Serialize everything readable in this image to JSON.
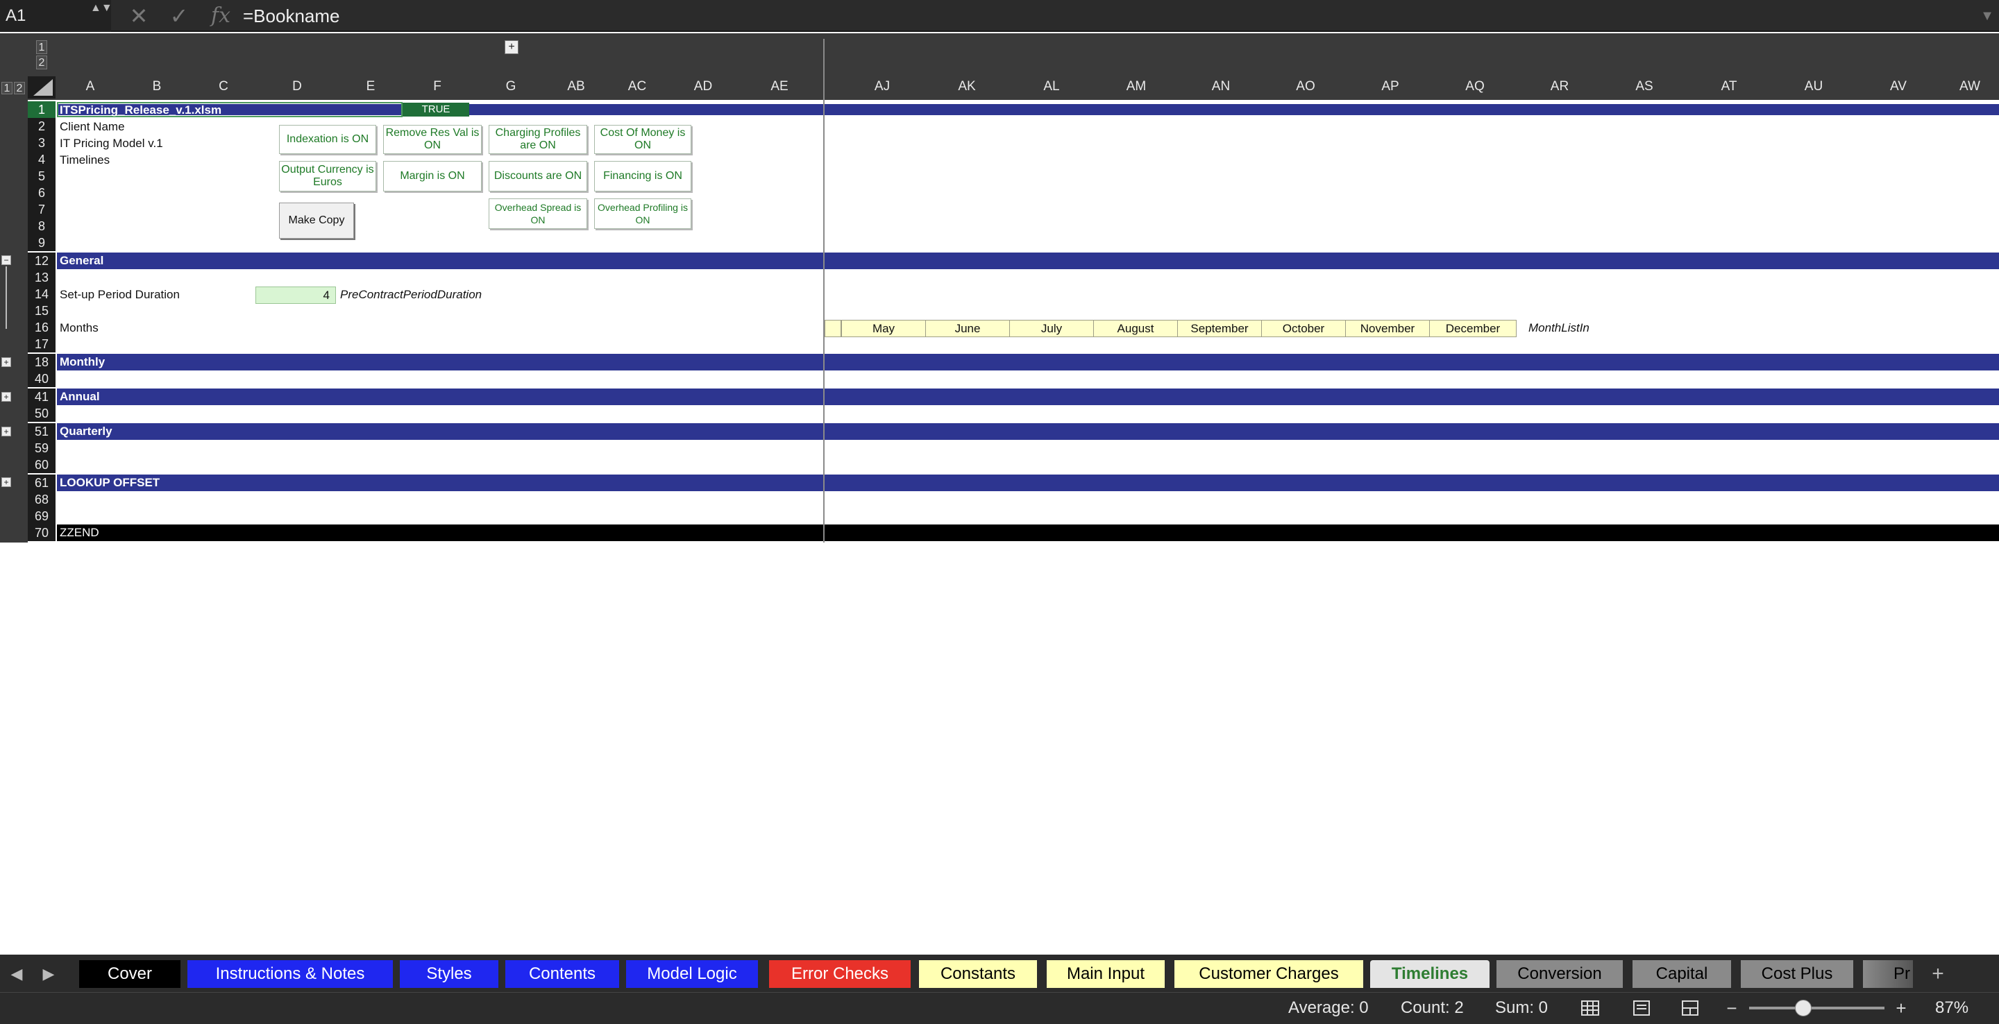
{
  "formula_bar": {
    "name_box": "A1",
    "spinner": "▲▼",
    "cancel_icon": "✕",
    "enter_icon": "✓",
    "fx_icon": "fx",
    "formula": "=Bookname"
  },
  "outline": {
    "levels": [
      "1",
      "2"
    ],
    "col_level_1": "1",
    "col_level_2": "2",
    "expand_symbol": "+",
    "collapse_symbol": "−"
  },
  "columns": [
    "A",
    "B",
    "C",
    "D",
    "E",
    "F",
    "G",
    "AB",
    "AC",
    "AD",
    "AE",
    "AJ",
    "AK",
    "AL",
    "AM",
    "AN",
    "AO",
    "AP",
    "AQ",
    "AR",
    "AS",
    "AT",
    "AU",
    "AV",
    "AW"
  ],
  "rows": [
    "1",
    "2",
    "3",
    "4",
    "5",
    "6",
    "7",
    "8",
    "9",
    "12",
    "13",
    "14",
    "15",
    "16",
    "17",
    "18",
    "40",
    "41",
    "50",
    "51",
    "59",
    "60",
    "61",
    "68",
    "69",
    "70"
  ],
  "cells": {
    "a1": "ITSPricing_Release_v.1.xlsm",
    "true_value": "TRUE",
    "a2": "Client Name",
    "a3": "IT Pricing Model v.1",
    "a4": "Timelines",
    "setup_label": "Set-up Period Duration",
    "setup_value": "4",
    "setup_name": "PreContractPeriodDuration",
    "months_label": "Months",
    "months_name": "MonthListIn",
    "zzend": "ZZEND"
  },
  "months": [
    "May",
    "June",
    "July",
    "August",
    "September",
    "October",
    "November",
    "December"
  ],
  "toggles": {
    "indexation": "Indexation is ON",
    "remove_res_val": "Remove Res Val is ON",
    "charging_profiles": "Charging Profiles are ON",
    "cost_of_money": "Cost Of Money is ON",
    "output_currency": "Output Currency is Euros",
    "margin": "Margin is ON",
    "discounts": "Discounts are ON",
    "financing": "Financing is ON",
    "overhead_spread": "Overhead Spread is ON",
    "overhead_profiling": "Overhead Profiling is ON",
    "make_copy": "Make Copy"
  },
  "sections": {
    "general": "General",
    "monthly": "Monthly",
    "annual": "Annual",
    "quarterly": "Quarterly",
    "lookup_offset": "LOOKUP OFFSET"
  },
  "tabs": [
    {
      "label": "Cover",
      "bg": "#000000",
      "fg": "#ffffff"
    },
    {
      "label": "Instructions & Notes",
      "bg": "#1f27f0",
      "fg": "#ffffff"
    },
    {
      "label": "Styles",
      "bg": "#1f27f0",
      "fg": "#ffffff"
    },
    {
      "label": "Contents",
      "bg": "#1f27f0",
      "fg": "#ffffff"
    },
    {
      "label": "Model Logic",
      "bg": "#1f27f0",
      "fg": "#ffffff"
    },
    {
      "label": "Error Checks",
      "bg": "#e8322a",
      "fg": "#ffffff"
    },
    {
      "label": "Constants",
      "bg": "#ffffb3",
      "fg": "#000000"
    },
    {
      "label": "Main Input",
      "bg": "#ffffb3",
      "fg": "#000000"
    },
    {
      "label": "Customer Charges",
      "bg": "#ffffb3",
      "fg": "#000000"
    },
    {
      "label": "Timelines",
      "bg": "#e4e4e4",
      "fg": "#2e7d32"
    },
    {
      "label": "Conversion",
      "bg": "#8a8a8a",
      "fg": "#000000"
    },
    {
      "label": "Capital",
      "bg": "#8a8a8a",
      "fg": "#000000"
    },
    {
      "label": "Cost Plus",
      "bg": "#8a8a8a",
      "fg": "#000000"
    },
    {
      "label": "Pr",
      "bg": "#8a8a8a",
      "fg": "#000000"
    }
  ],
  "tab_nav": {
    "prev": "◀",
    "next": "▶",
    "add": "+"
  },
  "status": {
    "average": "Average: 0",
    "count": "Count: 2",
    "sum": "Sum: 0",
    "zoom_minus": "−",
    "zoom_plus": "+",
    "zoom": "87%",
    "zoom_fraction": 0.4
  },
  "colors": {
    "section_band": "#2d3590",
    "selected_header": "#1f6e38",
    "toggle_text": "#1e7a26",
    "input_cell": "#d9f5d3",
    "month_cell": "#ffffcc"
  }
}
